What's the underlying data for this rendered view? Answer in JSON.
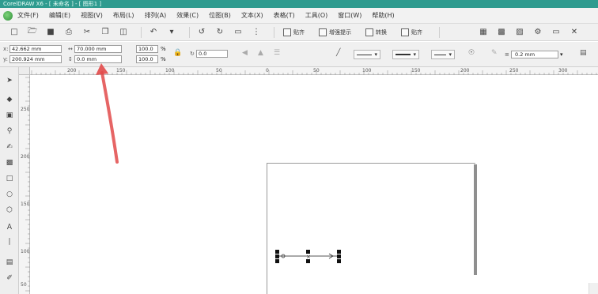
{
  "title_bar": {
    "text": "CorelDRAW X6 - [ 未命名 ] - [ 图形1 ]"
  },
  "menu": [
    "文件(F)",
    "编辑(E)",
    "视图(V)",
    "布局(L)",
    "排列(A)",
    "效果(C)",
    "位图(B)",
    "文本(X)",
    "表格(T)",
    "工具(O)",
    "窗口(W)",
    "帮助(H)"
  ],
  "standard_toolbar": {
    "buttons": [
      "贴齐",
      "增强提示",
      "转换",
      "贴齐"
    ]
  },
  "property_bar": {
    "x_label": "x:",
    "x_value": "42.662 mm",
    "y_label": "y:",
    "y_value": "200.924 mm",
    "width_value": "70.000 mm",
    "height_value": "0.0 mm",
    "scale_x": "100.0",
    "scale_y": "100.0",
    "scale_unit": "%",
    "angle_value": "0.0",
    "outline_width": "0.2 mm"
  },
  "ruler_h_labels": [
    "200",
    "150",
    "100",
    "50",
    "0",
    "50",
    "100",
    "150",
    "200",
    "250",
    "300"
  ],
  "ruler_v_labels": [
    "250",
    "200",
    "150",
    "100",
    "50"
  ]
}
